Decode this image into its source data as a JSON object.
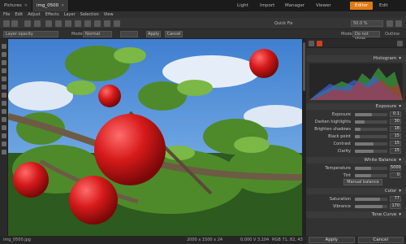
{
  "window": {
    "tabs": [
      {
        "label": "Pictures"
      },
      {
        "label": "img_0500"
      }
    ],
    "modes": [
      "Light",
      "Import",
      "Manager",
      "Viewer",
      "Editor",
      "Edit"
    ],
    "active_mode": "Editor"
  },
  "menu": [
    "File",
    "Edit",
    "Adjust",
    "Effects",
    "Layer",
    "Selection",
    "View"
  ],
  "toolbar1": {
    "quick_fix": "Quick Fix",
    "zoom": "50.0 %"
  },
  "toolbar2": {
    "layer_field": "Layer opacity",
    "mode_label": "Mode",
    "mode_value": "Normal",
    "apply": "Apply",
    "cancel": "Cancel",
    "right_mode_label": "Mode",
    "right_mode_value": "Do not show",
    "outline": "Outline"
  },
  "panel": {
    "histogram_title": "Histogram",
    "exposure_title": "Exposure",
    "exposure_rows": [
      {
        "label": "Exposure",
        "value": "0.1",
        "level": 0.52
      },
      {
        "label": "Darken highlights",
        "value": "30",
        "level": 0.3
      },
      {
        "label": "Brighten shadows",
        "value": "18",
        "level": 0.18
      },
      {
        "label": "Black point",
        "value": "15",
        "level": 0.15
      },
      {
        "label": "Contrast",
        "value": "15",
        "level": 0.58
      },
      {
        "label": "Clarity",
        "value": "15",
        "level": 0.58
      }
    ],
    "wb_title": "White Balance",
    "wb_rows": [
      {
        "label": "Temperature",
        "value": "5000",
        "level": 0.5
      },
      {
        "label": "Tint",
        "value": "0",
        "level": 0.5
      }
    ],
    "manual_balance": "Manual balance",
    "color_title": "Color",
    "color_rows": [
      {
        "label": "Saturation",
        "value": "77",
        "level": 0.77
      },
      {
        "label": "Vibrance",
        "value": "170",
        "level": 0.85
      }
    ],
    "tone_curve_title": "Tone Curve",
    "apply": "Apply",
    "cancel": "Cancel"
  },
  "status": {
    "file": "img_0500.jpg",
    "dims": "2000 x 1500 x 24",
    "info": "0,000 V 3,104",
    "rgb": "RGB 71, 82, 43"
  },
  "colors": {
    "accent": "#e07a16",
    "bg": "#2b2b2b",
    "panel": "#323232"
  }
}
